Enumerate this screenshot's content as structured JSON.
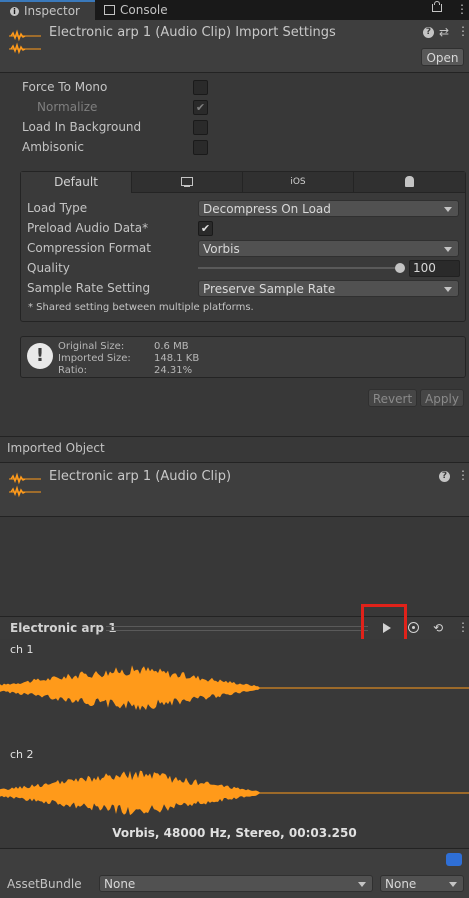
{
  "tabs": [
    {
      "label": "Inspector",
      "icon": "info-icon"
    },
    {
      "label": "Console",
      "icon": "console-icon"
    }
  ],
  "header": {
    "title": "Electronic arp 1 (Audio Clip) Import Settings",
    "open_label": "Open"
  },
  "options": {
    "force_to_mono": {
      "label": "Force To Mono",
      "checked": false
    },
    "normalize": {
      "label": "Normalize",
      "checked": true
    },
    "load_in_background": {
      "label": "Load In Background",
      "checked": false
    },
    "ambisonic": {
      "label": "Ambisonic",
      "checked": false
    }
  },
  "platform_tabs": [
    {
      "label": "Default"
    },
    {
      "label": "",
      "icon": "monitor-icon"
    },
    {
      "label": "iOS"
    },
    {
      "label": "",
      "icon": "android-icon"
    }
  ],
  "settings": {
    "load_type": {
      "label": "Load Type",
      "value": "Decompress On Load"
    },
    "preload": {
      "label": "Preload Audio Data*",
      "checked": true
    },
    "compression": {
      "label": "Compression Format",
      "value": "Vorbis"
    },
    "quality": {
      "label": "Quality",
      "value": "100",
      "level": 1.0
    },
    "sample_rate": {
      "label": "Sample Rate Setting",
      "value": "Preserve Sample Rate"
    },
    "note": "* Shared setting between multiple platforms."
  },
  "info": {
    "original_label": "Original Size:",
    "original_value": "0.6 MB",
    "imported_label": "Imported Size:",
    "imported_value": "148.1 KB",
    "ratio_label": "Ratio:",
    "ratio_value": "24.31%"
  },
  "actions": {
    "revert_label": "Revert",
    "apply_label": "Apply"
  },
  "imported_object": {
    "section_label": "Imported Object",
    "title": "Electronic arp 1 (Audio Clip)"
  },
  "preview": {
    "title": "Electronic arp 1",
    "channels": [
      "ch 1",
      "ch 2"
    ],
    "info": "Vorbis, 48000 Hz, Stereo, 00:03.250",
    "wave_color": "#ff9a1a"
  },
  "footer": {
    "label": "AssetBundle",
    "bundle_value": "None",
    "variant_value": "None"
  },
  "colors": {
    "highlight": "#e0221a",
    "accent": "#3a79bb"
  }
}
